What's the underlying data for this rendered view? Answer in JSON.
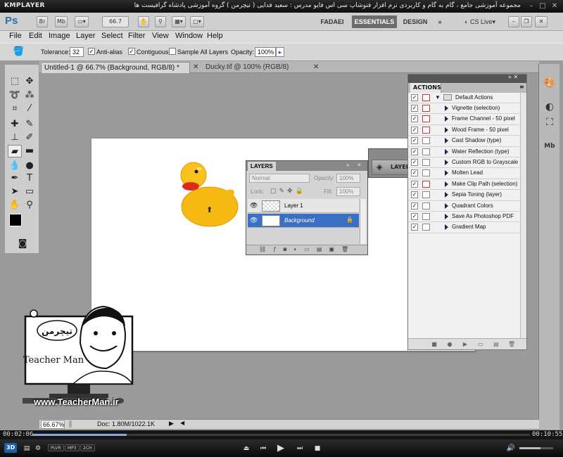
{
  "player": {
    "name": "KMPLAYER",
    "window_title": "مجموعه آموزشی جامع ، گام به گام و کاربردی نرم افزار فتوشاپ سی اس فایو   مدرس : سعید فدایی ( تیچرمن ) گروه آموزشی پادشاه گرافیست ها",
    "elapsed": "00:02:06",
    "total": "00:10:55",
    "progress": 0.19,
    "volume": 0.62,
    "mode_label": "3D",
    "badges": [
      "PLVR",
      "MP3",
      "2CH"
    ]
  },
  "photoshop": {
    "logo": "Ps",
    "bridge_btn": "Br",
    "minibridge_btn": "Mb",
    "zoom_level": "66.7",
    "workspaces": [
      "FADAEI",
      "ESSENTIALS",
      "DESIGN"
    ],
    "active_workspace": "ESSENTIALS",
    "more": "»",
    "cs_live": "CS Live"
  },
  "menu": [
    "File",
    "Edit",
    "Image",
    "Layer",
    "Select",
    "Filter",
    "View",
    "Window",
    "Help"
  ],
  "options": {
    "tolerance_label": "Tolerance:",
    "tolerance_value": "32",
    "antialias_label": "Anti-alias",
    "contiguous_label": "Contiguous",
    "sample_all_label": "Sample All Layers",
    "opacity_label": "Opacity:",
    "opacity_value": "100%"
  },
  "tabs": [
    {
      "label": "Untitled-1 @ 66.7% (Background, RGB/8) *",
      "active": true
    },
    {
      "label": "Ducky.tif @ 100% (RGB/8)",
      "active": false
    }
  ],
  "status": {
    "zoom": "66.67%",
    "doc": "Doc: 1.80M/1022.1K"
  },
  "actions_panel": {
    "title": "ACTIONS",
    "set_name": "Default Actions",
    "items": [
      "Vignette (selection)",
      "Frame Channel - 50 pixel",
      "Wood Frame - 50 pixel",
      "Cast Shadow (type)",
      "Water Reflection (type)",
      "Custom RGB to Grayscale",
      "Molten Lead",
      "Make Clip Path (selection)",
      "Sepia Toning (layer)",
      "Quadrant Colors",
      "Save As Photoshop PDF",
      "Gradient Map"
    ]
  },
  "layers_panel": {
    "title": "LAYERS",
    "blend_mode": "Normal",
    "opacity_label": "Opacity:",
    "opacity_value": "100%",
    "lock_label": "Lock:",
    "fill_label": "Fill:",
    "fill_value": "100%",
    "layers": [
      "Layer 1",
      "Background"
    ],
    "collapsed_label": "LAYERS"
  },
  "watermark": {
    "name": "Teacher Man",
    "persian_name": "تیچرمن",
    "url": "www.TeacherMan.ir"
  },
  "colors": {
    "selected_layer": "#3b6fc4",
    "duck_yellow": "#f5b811",
    "beak_red": "#d82a1a"
  }
}
